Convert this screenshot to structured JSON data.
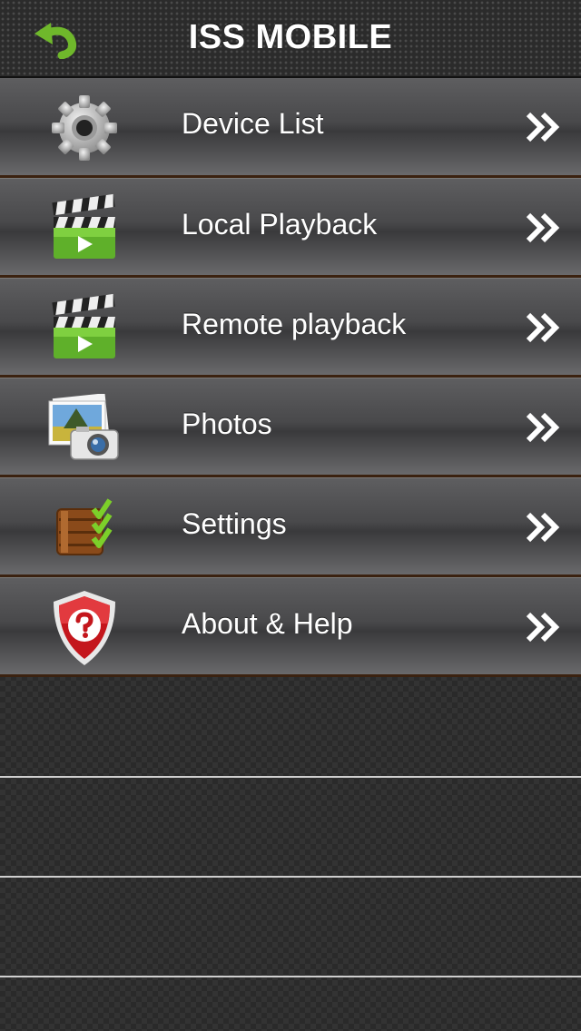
{
  "header": {
    "title": "ISS MOBILE",
    "back_icon": "undo-arrow-icon"
  },
  "menu": {
    "items": [
      {
        "label": "Device List",
        "icon": "gear-icon"
      },
      {
        "label": "Local Playback",
        "icon": "clapperboard-icon"
      },
      {
        "label": "Remote playback",
        "icon": "clapperboard-icon"
      },
      {
        "label": "Photos",
        "icon": "photos-camera-icon"
      },
      {
        "label": "Settings",
        "icon": "checklist-icon"
      },
      {
        "label": "About & Help",
        "icon": "help-shield-icon"
      }
    ],
    "chevron_icon": "double-chevron-right-icon"
  },
  "colors": {
    "accent_green": "#6db62a",
    "row_border": "#3b2210"
  }
}
